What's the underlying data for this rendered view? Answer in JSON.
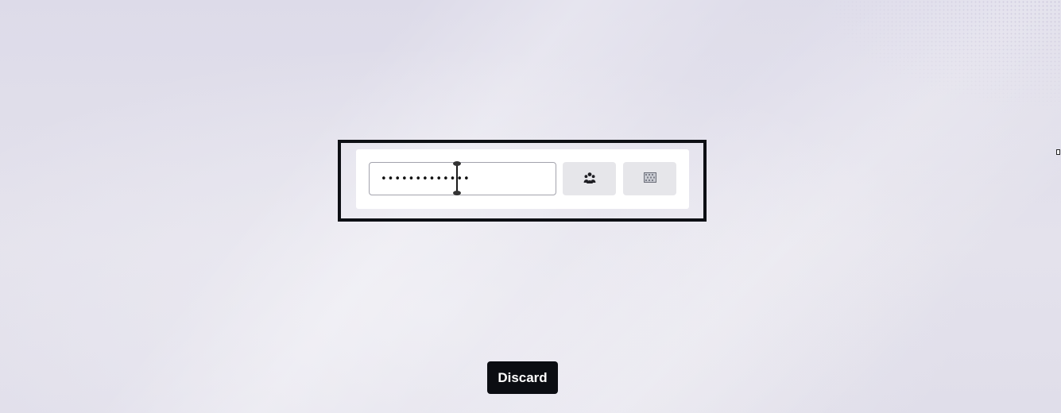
{
  "password_field": {
    "value": "•••••••••••••"
  },
  "buttons": {
    "group_icon": "users-group-icon",
    "grid_icon": "pattern-grid-icon",
    "discard_label": "Discard"
  },
  "colors": {
    "background": "#dcdae8",
    "frame_border": "#0d0f14",
    "discard_bg": "#0b0d12",
    "icon_button_bg": "#e6e6ea"
  }
}
